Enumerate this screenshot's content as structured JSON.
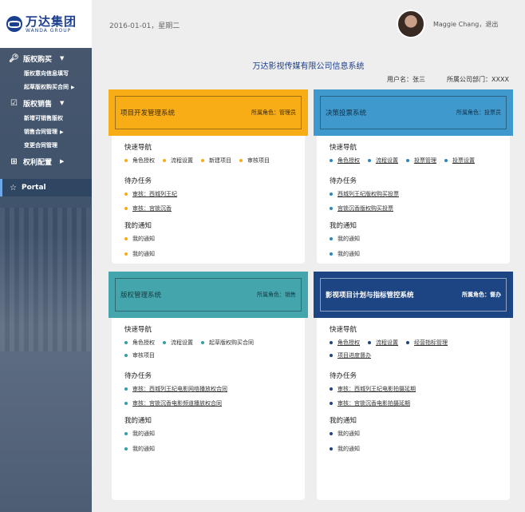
{
  "header": {
    "logo_cn": "万达集团",
    "logo_en": "WANDA GROUP",
    "date": "2016-01-01，星期二",
    "user": "Maggie Chang，退出"
  },
  "sidebar": {
    "groups": [
      {
        "label": "版权购买",
        "icon": "key-icon",
        "items": [
          {
            "label": "版权意向信息填写"
          },
          {
            "label": "起草版权购买合同",
            "arrow": "▶"
          }
        ]
      },
      {
        "label": "版权销售",
        "icon": "checkbox-icon",
        "items": [
          {
            "label": "新增可销售版权"
          },
          {
            "label": "销售合同管理",
            "arrow": "▶"
          },
          {
            "label": "变更合同管理"
          }
        ]
      },
      {
        "label": "权利配置",
        "icon": "grid-icon",
        "items": []
      }
    ],
    "portal": "Portal"
  },
  "main": {
    "system_title": "万达影视传媒有限公司信息系统",
    "username_label": "用户名：张三",
    "dept_label": "所属公司部门：XXXX"
  },
  "cards": [
    {
      "title": "项目开发管理系统",
      "role": "所属角色：管理员",
      "color": "#f8ac16",
      "dot": "#f8ac16",
      "nav_title": "快速导航",
      "nav": [
        "角色授权",
        "流程设置",
        "新建项目",
        "审核项目"
      ],
      "task_title": "待办任务",
      "tasks": [
        "审核：西城列王纪",
        "审核：宫锁沉香"
      ],
      "notice_title": "我的通知",
      "notices": [
        "我的通知",
        "我的通知"
      ]
    },
    {
      "title": "决策投票系统",
      "role": "所属角色：投票员",
      "color": "#3f99cd",
      "dot": "#2a86c2",
      "nav_title": "快速导航",
      "nav": [
        "角色授权",
        "流程设置",
        "投票管理",
        "投票设置"
      ],
      "task_title": "待办任务",
      "tasks": [
        "西城列王纪版权购买投票",
        "宫锁沉香版权购买投票"
      ],
      "notice_title": "我的通知",
      "notices": [
        "我的通知",
        "我的通知"
      ]
    },
    {
      "title": "版权管理系统",
      "role": "所属角色：销售",
      "color": "#44a5ad",
      "dot": "#35a0a6",
      "nav_title": "快速导航",
      "nav": [
        "角色授权",
        "流程设置",
        "起草版权购买合同",
        "审核项目"
      ],
      "task_title": "待办任务",
      "tasks": [
        "审核：西城列王纪电影网络播放权合同",
        "审核：宫锁沉香电影频道播放权合同"
      ],
      "notice_title": "我的通知",
      "notices": [
        "我的通知",
        "我的通知"
      ]
    },
    {
      "title": "影视项目计划与指标管控系统",
      "role": "所属角色：督办",
      "color": "#1e4583",
      "dot": "#1e4583",
      "nav_title": "快速导航",
      "nav": [
        "角色授权",
        "流程设置",
        "经营指标管理",
        "项目进度督办"
      ],
      "task_title": "待办任务",
      "tasks": [
        "审核：西城列王纪电影拍摄延期",
        "审核：宫锁沉香电影拍摄延期"
      ],
      "notice_title": "我的通知",
      "notices": [
        "我的通知",
        "我的通知"
      ]
    }
  ]
}
